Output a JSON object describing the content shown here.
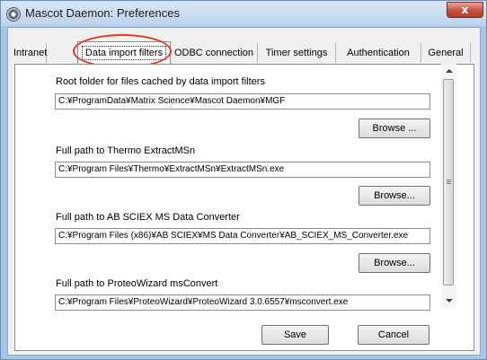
{
  "window": {
    "title": "Mascot Daemon: Preferences",
    "close_glyph": "x"
  },
  "tabs": [
    {
      "label": "Intranet",
      "active": false
    },
    {
      "label": "Data import filters",
      "active": true
    },
    {
      "label": "ODBC connection",
      "active": false
    },
    {
      "label": "Timer settings",
      "active": false
    },
    {
      "label": "Authentication",
      "active": false
    },
    {
      "label": "General",
      "active": false
    }
  ],
  "fields": [
    {
      "label": "Root folder for files cached by data import filters",
      "value": "C:¥ProgramData¥Matrix Science¥Mascot Daemon¥MGF",
      "button": "Browse ..."
    },
    {
      "label": "Full path to Thermo ExtractMSn",
      "value": "C:¥Program Files¥Thermo¥ExtractMSn¥ExtractMSn.exe",
      "button": "Browse..."
    },
    {
      "label": "Full path to AB SCIEX MS Data Converter",
      "value": "C:¥Program Files (x86)¥AB SCIEX¥MS Data Converter¥AB_SCIEX_MS_Converter.exe",
      "button": "Browse..."
    },
    {
      "label": "Full path to ProteoWizard msConvert",
      "value": "C:¥Program Files¥ProteoWizard¥ProteoWizard 3.0.6557¥msconvert.exe"
    }
  ],
  "footer": {
    "save_label": "Save",
    "cancel_label": "Cancel"
  },
  "colors": {
    "highlight_ring": "#e2352b",
    "close_button": "#c7513f"
  }
}
